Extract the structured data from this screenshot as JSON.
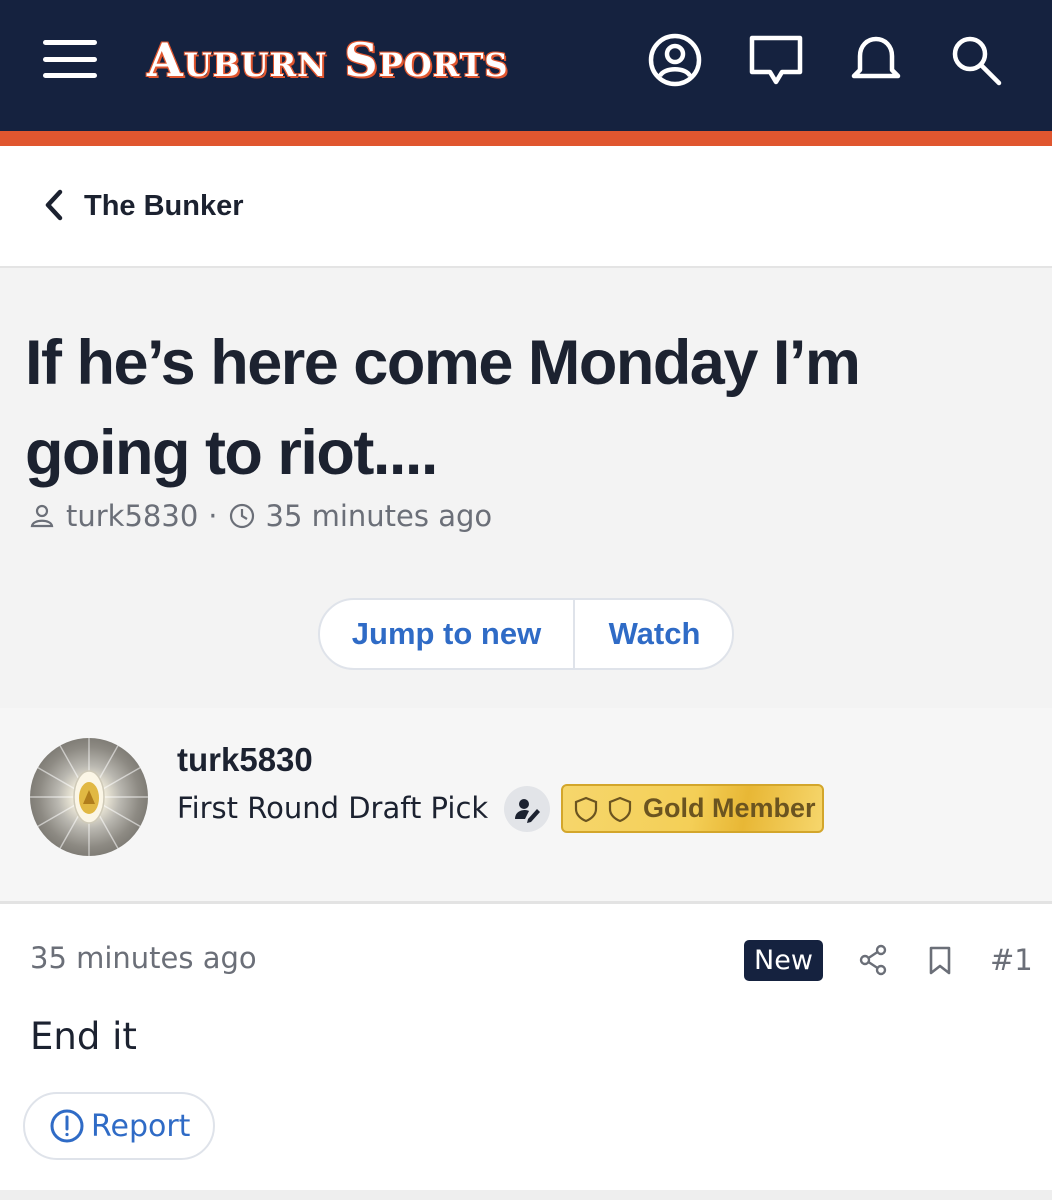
{
  "header": {
    "logo_text": "Auburn Sports",
    "colors": {
      "navy": "#15223f",
      "orange": "#e0562f"
    },
    "icons": [
      "menu-icon",
      "account-icon",
      "messages-icon",
      "alerts-icon",
      "search-icon"
    ]
  },
  "breadcrumb": {
    "label": "The Bunker"
  },
  "thread": {
    "title": "If he’s here come Monday I’m going to riot....",
    "author": "turk5830",
    "separator": "·",
    "time": "35 minutes ago",
    "buttons": {
      "jump": "Jump to new",
      "watch": "Watch"
    }
  },
  "author_card": {
    "name": "turk5830",
    "title": "First Round Draft Pick",
    "badge": "Gold Member"
  },
  "post": {
    "time": "35 minutes ago",
    "new_label": "New",
    "number": "#1",
    "body": "End it",
    "report_label": "Report"
  }
}
